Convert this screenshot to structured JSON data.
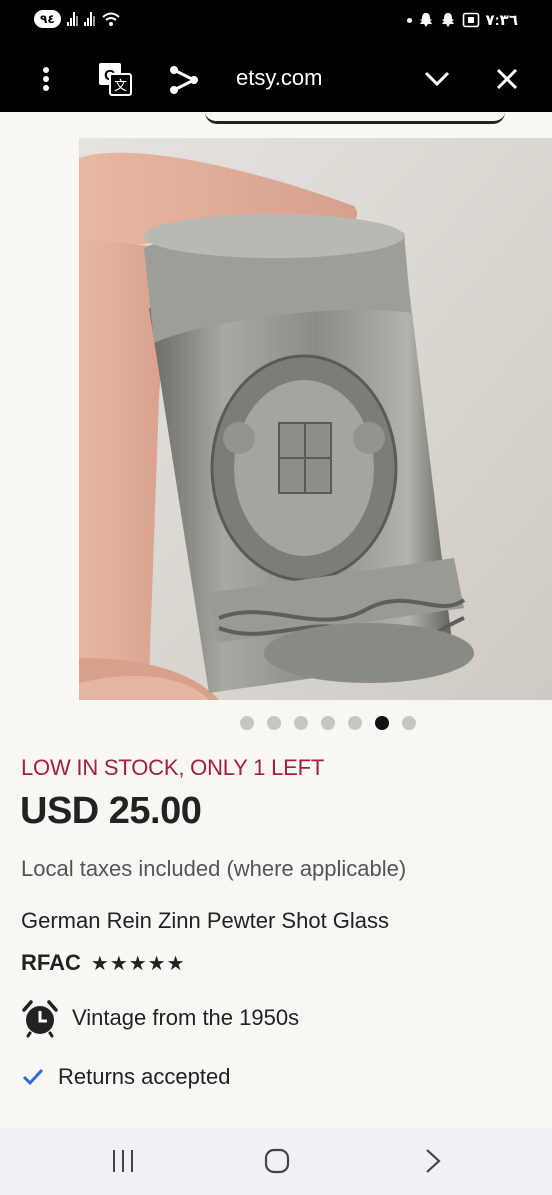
{
  "status_bar": {
    "battery": "٩٤",
    "time": "٧:٣٦"
  },
  "browser": {
    "url": "etsy.com",
    "icons": [
      "more-vert-icon",
      "translate-icon",
      "share-icon",
      "chevron-down-icon",
      "close-icon"
    ]
  },
  "carousel": {
    "count": 7,
    "active_index": 5
  },
  "product": {
    "stock": "LOW IN STOCK, ONLY 1 LEFT",
    "price": "USD 25.00",
    "taxes": "Local taxes included (where applicable)",
    "title": "German Rein Zinn Pewter Shot Glass",
    "shop": "RFAC",
    "stars": "★★★★★",
    "rating": 5,
    "vintage": "Vintage from the 1950s",
    "returns": "Returns accepted"
  },
  "colors": {
    "stock_red": "#a2203e",
    "check_blue": "#2f6bd8",
    "background": "#f8f7f3"
  }
}
